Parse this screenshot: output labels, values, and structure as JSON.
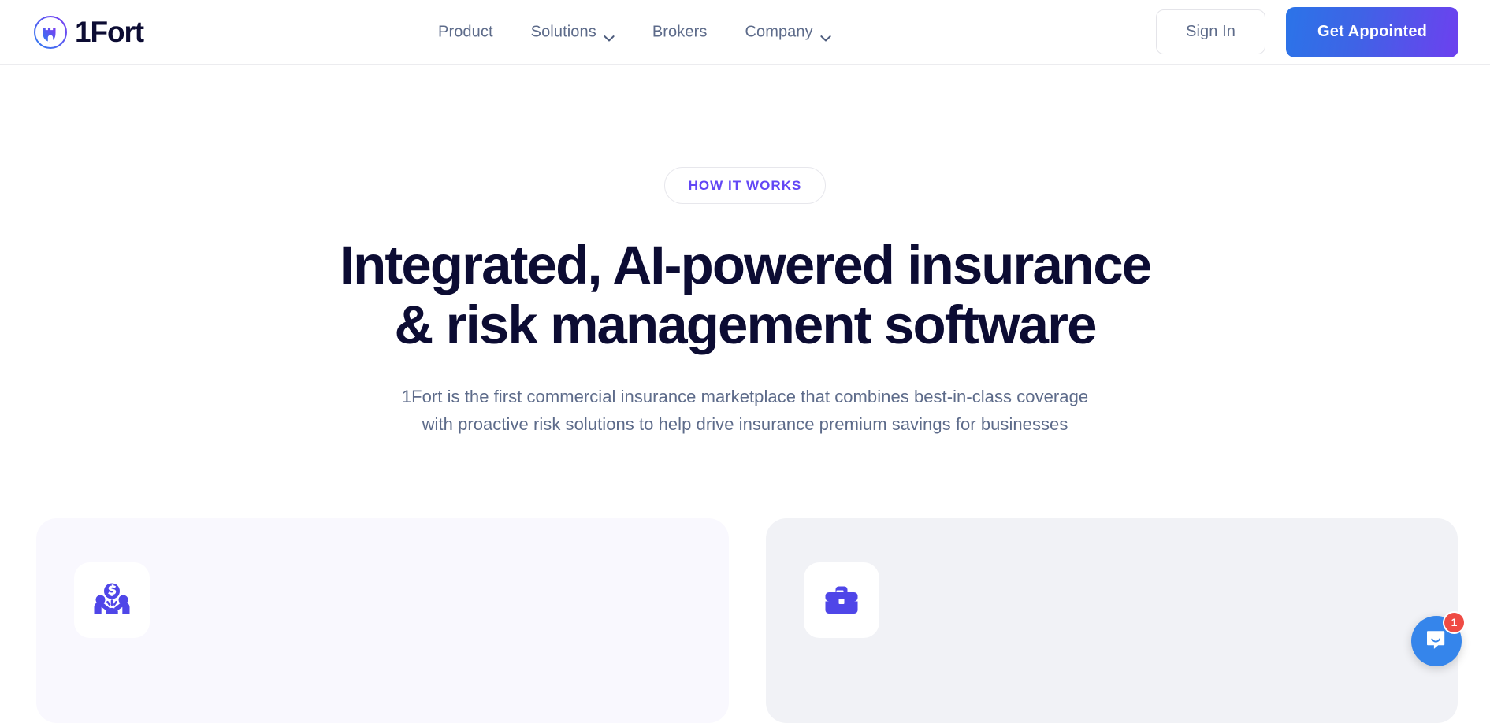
{
  "header": {
    "brand": {
      "name": "1Fort",
      "icon": "fort-castle-icon"
    },
    "nav": [
      {
        "label": "Product",
        "has_dropdown": false,
        "name": "nav-item-product"
      },
      {
        "label": "Solutions",
        "has_dropdown": true,
        "name": "nav-item-solutions"
      },
      {
        "label": "Brokers",
        "has_dropdown": false,
        "name": "nav-item-brokers"
      },
      {
        "label": "Company",
        "has_dropdown": true,
        "name": "nav-item-company"
      }
    ],
    "sign_in_label": "Sign In",
    "cta_label": "Get Appointed"
  },
  "hero": {
    "eyebrow": "HOW IT WORKS",
    "title_line1": "Integrated, AI-powered insurance",
    "title_line2": "& risk management software",
    "subtitle_line1": "1Fort is the first commercial insurance marketplace that combines best-in-class coverage",
    "subtitle_line2": "with proactive risk solutions to help drive insurance premium savings for businesses"
  },
  "cards": [
    {
      "icon": "handshake-money-icon",
      "tint": "tint-violet",
      "name": "feature-card-insurance"
    },
    {
      "icon": "briefcase-icon",
      "tint": "tint-slate",
      "name": "feature-card-brokers"
    }
  ],
  "chat": {
    "icon": "chat-bubble-smile-icon",
    "unread_count": "1"
  },
  "colors": {
    "brand_ink": "#0c0c33",
    "accent_purple": "#6247f5",
    "icon_purple": "#4f46e8",
    "nav_text": "#5d6b8a",
    "cta_gradient_start": "#2b74e8",
    "cta_gradient_end": "#6d40ef",
    "chat_blue": "#3585eb",
    "badge_red": "#ef4b44",
    "card_violet": "#f9f8fe",
    "card_slate": "#f1f2f6"
  }
}
